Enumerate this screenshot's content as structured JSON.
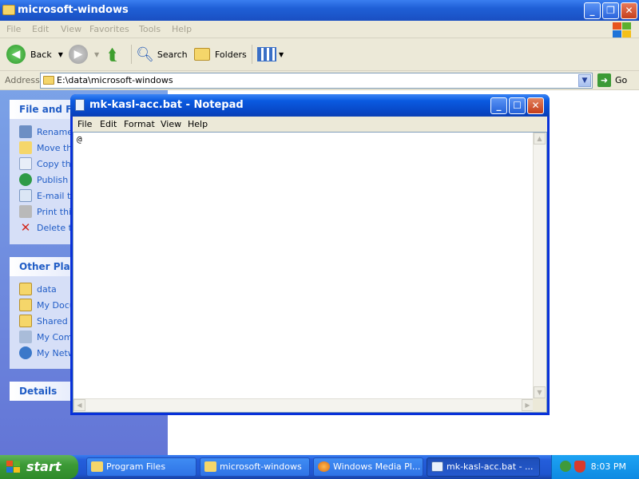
{
  "explorer": {
    "title": "microsoft-windows",
    "menu": [
      "File",
      "Edit",
      "View",
      "Favorites",
      "Tools",
      "Help"
    ],
    "toolbar": {
      "back": "Back",
      "search": "Search",
      "folders": "Folders"
    },
    "address": {
      "label": "Address",
      "value": "E:\\data\\microsoft-windows",
      "go": "Go"
    },
    "taskpane": {
      "file_tasks": {
        "title": "File and Fol",
        "items": [
          "Rename",
          "Move th",
          "Copy thi",
          "Publish t",
          "E-mail th",
          "Print this",
          "Delete th"
        ]
      },
      "other_places": {
        "title": "Other Place",
        "items": [
          "data",
          "My Docu",
          "Shared D",
          "My Comp",
          "My Netw"
        ]
      },
      "details": {
        "title": "Details"
      }
    }
  },
  "notepad": {
    "title": "mk-kasl-acc.bat - Notepad",
    "menu": [
      "File",
      "Edit",
      "Format",
      "View",
      "Help"
    ],
    "content": "@"
  },
  "taskbar": {
    "start": "start",
    "tasks": [
      {
        "label": "Program Files",
        "icon": "folder-icon",
        "active": false
      },
      {
        "label": "microsoft-windows",
        "icon": "folder-icon",
        "active": false
      },
      {
        "label": "Windows Media Pl...",
        "icon": "media-player-icon",
        "active": false
      },
      {
        "label": "mk-kasl-acc.bat - ...",
        "icon": "notepad-icon",
        "active": true
      }
    ],
    "clock": "8:03 PM"
  },
  "colors": {
    "title_blue": "#0a5ae0",
    "taskbar_blue": "#245edb",
    "start_green": "#3c9a36",
    "link_blue": "#215dc6"
  }
}
